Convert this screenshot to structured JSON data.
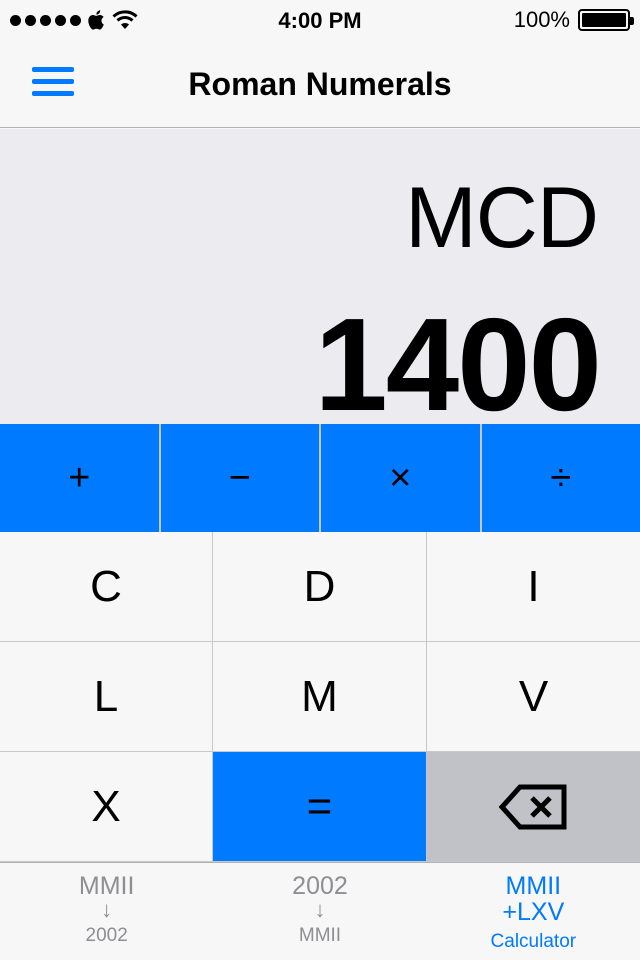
{
  "status_bar": {
    "time": "4:00 PM",
    "battery_percent": "100%",
    "battery_level": 1.0
  },
  "nav": {
    "title": "Roman Numerals",
    "menu_icon": "hamburger-menu-icon"
  },
  "display": {
    "roman": "MCD",
    "number": "1400"
  },
  "operators": [
    {
      "label": "+",
      "name": "add"
    },
    {
      "label": "−",
      "name": "subtract"
    },
    {
      "label": "×",
      "name": "multiply"
    },
    {
      "label": "÷",
      "name": "divide"
    }
  ],
  "keys": [
    {
      "label": "C"
    },
    {
      "label": "D"
    },
    {
      "label": "I"
    },
    {
      "label": "L"
    },
    {
      "label": "M"
    },
    {
      "label": "V"
    },
    {
      "label": "X"
    },
    {
      "label": "="
    },
    {
      "label": "",
      "icon": "backspace-icon"
    }
  ],
  "tabs": [
    {
      "top": "MMII",
      "arrow": "↓",
      "label": "2002",
      "active": false
    },
    {
      "top": "2002",
      "arrow": "↓",
      "label": "MMII",
      "active": false
    },
    {
      "top": "MMII",
      "top2": "+LXV",
      "label": "Calculator",
      "active": true
    }
  ],
  "colors": {
    "accent": "#007aff",
    "backspace_key": "#c1c2c7",
    "display_bg": "#ebebf0"
  }
}
